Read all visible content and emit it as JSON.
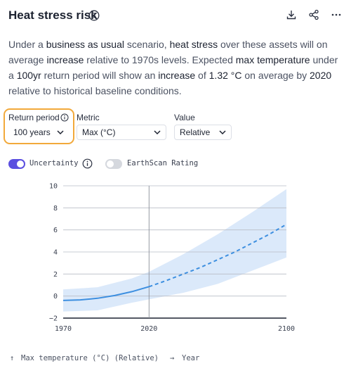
{
  "header": {
    "title": "Heat stress risk",
    "actions": [
      "download-icon",
      "share-icon",
      "more-icon"
    ]
  },
  "description": {
    "p1": "Under a ",
    "b1": "business as usual",
    "p2": " scenario, ",
    "b2": "heat stress",
    "p3": " over these assets will on average ",
    "b3": "increase",
    "p4": " relative to 1970s levels. Expected ",
    "b4": "max temperature",
    "p5": " under a ",
    "b5": "100yr",
    "p6": " return period will show an ",
    "b6": "increase",
    "p7": " of ",
    "b7": "1.32 °C",
    "p8": " on average by ",
    "b8": "2020",
    "p9": " relative to historical baseline conditions."
  },
  "filters": {
    "return_period": {
      "label": "Return period",
      "value": "100 years"
    },
    "metric": {
      "label": "Metric",
      "value": "Max (°C)"
    },
    "value": {
      "label": "Value",
      "value": "Relative"
    }
  },
  "toggles": {
    "uncertainty": {
      "label": "Uncertainty",
      "on": true
    },
    "earthscan": {
      "label": "EarthScan Rating",
      "on": false
    }
  },
  "colors": {
    "accent": "#5b4fe0",
    "highlight": "#f2a93b",
    "line": "#3d8fe0",
    "band": "#dbe9fa"
  },
  "chart_data": {
    "type": "line",
    "x_ticks": [
      "1970",
      "2020",
      "2100"
    ],
    "y_ticks": [
      "10",
      "8",
      "6",
      "4",
      "2",
      "0",
      "−2"
    ],
    "xlim": [
      1970,
      2100
    ],
    "ylim": [
      -2,
      10
    ],
    "marker_year": 2020,
    "series": [
      {
        "style": "solid",
        "x": [
          1970,
          1980,
          1990,
          2000,
          2010,
          2020
        ],
        "y": [
          -0.4,
          -0.35,
          -0.2,
          0.05,
          0.4,
          0.85
        ]
      },
      {
        "style": "dashed",
        "x": [
          2020,
          2030,
          2040,
          2050,
          2060,
          2070,
          2080,
          2090,
          2100
        ],
        "y": [
          0.85,
          1.4,
          2.0,
          2.6,
          3.3,
          4.0,
          4.8,
          5.6,
          6.5
        ]
      }
    ],
    "band": {
      "x": [
        1970,
        1990,
        2010,
        2020,
        2040,
        2060,
        2080,
        2100
      ],
      "upper": [
        0.6,
        0.8,
        1.6,
        2.2,
        3.8,
        5.6,
        7.6,
        9.7
      ],
      "lower": [
        -1.4,
        -1.3,
        -0.6,
        -0.3,
        0.3,
        1.1,
        2.3,
        3.5
      ]
    },
    "xlabel": "Year",
    "ylabel": "Max temperature (°C) (Relative)"
  }
}
